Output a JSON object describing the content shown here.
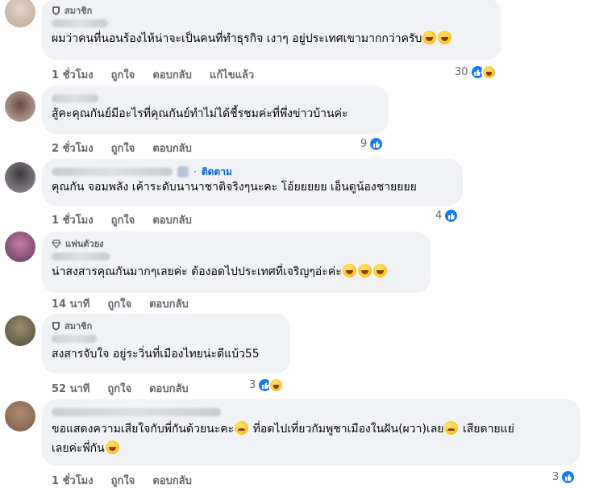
{
  "colors": {
    "bubble": "#f0f2f5",
    "like_blue": "#1877f2",
    "link_blue": "#0064d1",
    "meta_gray": "#65676b"
  },
  "comments": [
    {
      "badge": "สมาชิก",
      "badge_icon": "member-shield-icon",
      "text": "ผมว่าคนที่นอนร้องไห้น่าจะเป็นคนที่ทำธุรกิจ เงาๆ อยู่ประเทศเขามากกว่าครับ",
      "time": "1 ชั่วโมง",
      "like": "ถูกใจ",
      "reply": "ตอบกลับ",
      "edited": "แก้ไขแล้ว",
      "reaction_count": "30",
      "reactions": [
        "like-icon",
        "haha-icon"
      ]
    },
    {
      "text": "สู้คะคุณกันย์มีอะไรที่คุณกันย์ทำไม่ได้ชี้รชมค่ะที่พึ่งข่าวบ้านค่ะ",
      "time": "2 ชั่วโมง",
      "like": "ถูกใจ",
      "reply": "ตอบกลับ",
      "reaction_count": "9",
      "reactions": [
        "like-icon"
      ]
    },
    {
      "follow": "ติดตาม",
      "text": "คุณกัน จอมพลัง เค้าระดับนานาชาติจริงๆนะคะ โอ้ยยยยย เอ็นดูน้องชายยยย",
      "time": "1 ชั่วโมง",
      "like": "ถูกใจ",
      "reply": "ตอบกลับ",
      "reaction_count": "4",
      "reactions": [
        "like-icon"
      ]
    },
    {
      "badge": "แฟนตัวยง",
      "badge_icon": "diamond-icon",
      "text": "น่าสงสารคุณกันมากๆเลยค่ะ ต้องอดไปประเทศที่เจริญๆอ่ะค่ะ",
      "time": "14 นาที",
      "like": "ถูกใจ",
      "reply": "ตอบกลับ"
    },
    {
      "badge": "สมาชิก",
      "badge_icon": "member-shield-icon",
      "text": "สงสารจับใจ อยู่ระวิ่นที่เมืองไทยน่ะดีแบ้ว55",
      "time": "52 นาที",
      "like": "ถูกใจ",
      "reply": "ตอบกลับ",
      "reaction_count": "3",
      "reactions": [
        "like-icon",
        "haha-icon"
      ]
    },
    {
      "text_a": "ขอแสดงความเสียใจกับพี่กันด้วยนะคะ",
      "text_b": "ที่อดไปเที่ยวกัมพูชาเมืองในฝัน(ผวา)เลย",
      "text_c": "เสียดายแย่",
      "text_d": "เลยค่ะพี่กัน",
      "time": "1 ชั่วโมง",
      "like": "ถูกใจ",
      "reply": "ตอบกลับ",
      "reaction_count": "3",
      "reactions": [
        "like-icon"
      ]
    }
  ]
}
